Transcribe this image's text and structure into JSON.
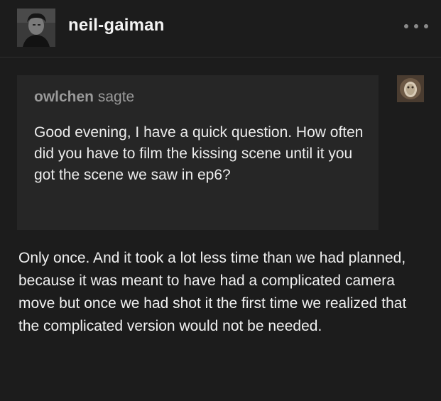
{
  "header": {
    "username": "neil-gaiman",
    "more_icon": "more-horizontal-icon"
  },
  "ask": {
    "asker": "owlchen",
    "verb": "sagte",
    "question": "Good evening, I have a quick question. How often did you have to film the kissing scene until it you got the scene we saw in ep6?"
  },
  "answer": {
    "text": "Only once. And it took a lot less time than we had planned, because it was meant to have had a complicated camera move but once we had shot it the first time we realized that the complicated version would not be needed."
  }
}
